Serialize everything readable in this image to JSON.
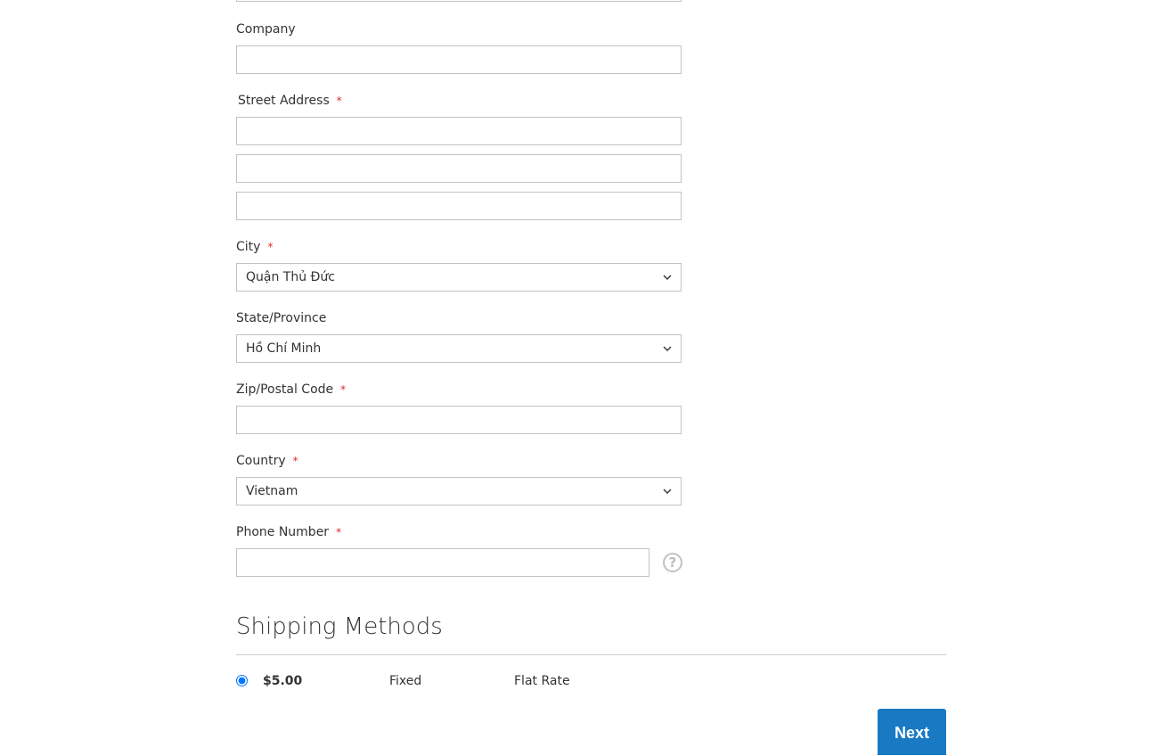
{
  "form": {
    "company": {
      "label": "Company",
      "value": "",
      "required": false
    },
    "street_address": {
      "label": "Street Address",
      "required": true,
      "lines": [
        "",
        "",
        ""
      ]
    },
    "city": {
      "label": "City",
      "required": true,
      "selected": "Quận Thủ Đức"
    },
    "state": {
      "label": "State/Province",
      "required": false,
      "selected": "Hồ Chí Minh"
    },
    "zip": {
      "label": "Zip/Postal Code",
      "required": true,
      "value": ""
    },
    "country": {
      "label": "Country",
      "required": true,
      "selected": "Vietnam"
    },
    "phone": {
      "label": "Phone Number",
      "required": true,
      "value": "",
      "help_icon": "question-circle-icon",
      "help_glyph": "?"
    },
    "required_marker": "*"
  },
  "shipping": {
    "title": "Shipping Methods",
    "methods": [
      {
        "selected": true,
        "price": "$5.00",
        "type": "Fixed",
        "carrier": "Flat Rate"
      }
    ]
  },
  "actions": {
    "next_label": "Next"
  },
  "colors": {
    "accent": "#1979c3",
    "required": "#e02b27",
    "border": "#c2c2c2"
  }
}
